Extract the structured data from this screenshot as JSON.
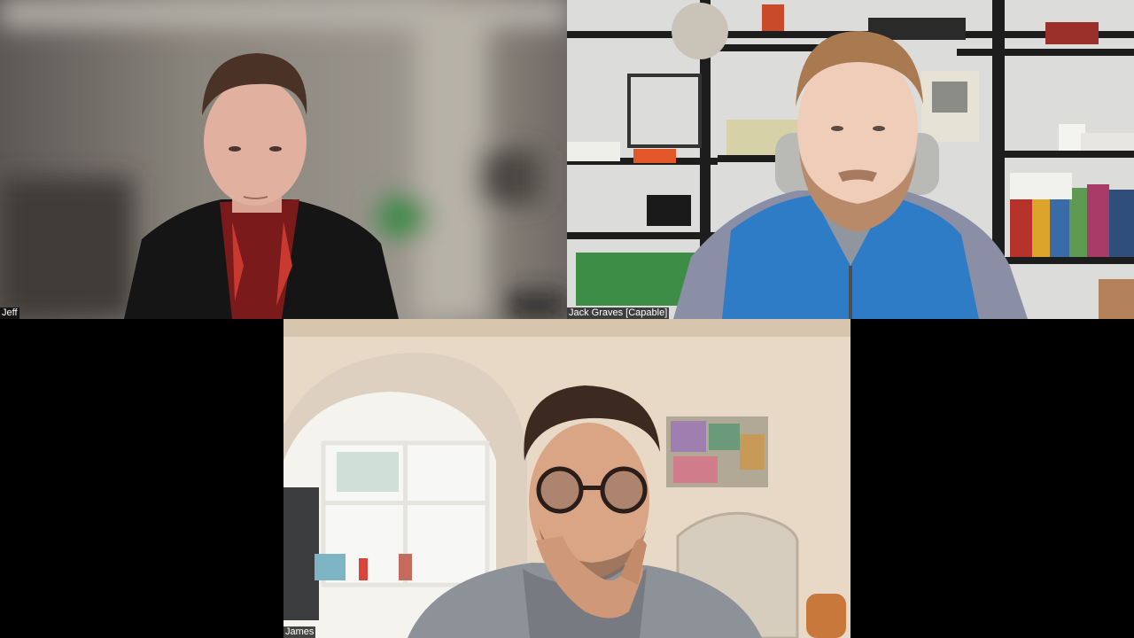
{
  "participants": [
    {
      "name": "Jeff"
    },
    {
      "name": "Jack Graves [Capable]"
    },
    {
      "name": "James"
    }
  ]
}
